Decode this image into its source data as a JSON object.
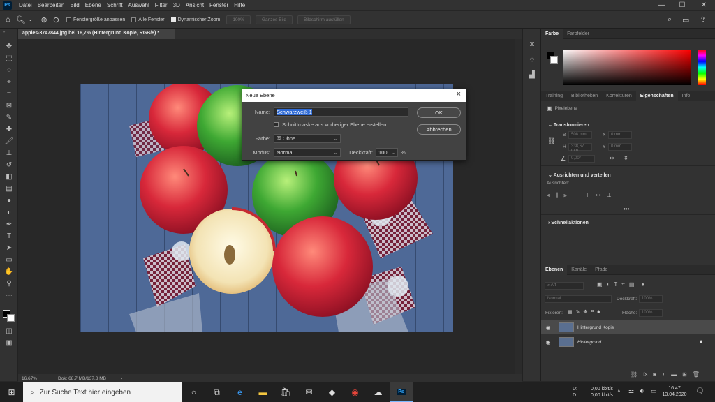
{
  "menubar": {
    "logo": "Ps",
    "items": [
      "Datei",
      "Bearbeiten",
      "Bild",
      "Ebene",
      "Schrift",
      "Auswahl",
      "Filter",
      "3D",
      "Ansicht",
      "Fenster",
      "Hilfe"
    ],
    "minimize": "—",
    "maximize": "☐",
    "close": "✕"
  },
  "options": {
    "fit_window": "Fenstergröße anpassen",
    "all_windows": "Alle Fenster",
    "dynamic_zoom": "Dynamischer Zoom",
    "zoom_value": "100%",
    "whole_image": "Ganzes Bild",
    "fill_screen": "Bildschirm ausfüllen"
  },
  "document": {
    "tab_title": "apples-3747844.jpg bei 16,7% (Hintergrund Kopie, RGB/8) *",
    "zoom": "16,67%",
    "doc_info": "Dok: 68,7 MB/137,3 MB"
  },
  "dialog": {
    "title": "Neue Ebene",
    "name_label": "Name:",
    "name_value": "Schwarzweiß 1",
    "clip_mask": "Schnittmaske aus vorheriger Ebene erstellen",
    "color_label": "Farbe:",
    "color_value": "Ohne",
    "mode_label": "Modus:",
    "mode_value": "Normal",
    "opacity_label": "Deckkraft:",
    "opacity_value": "100",
    "opacity_unit": "%",
    "ok": "OK",
    "cancel": "Abbrechen"
  },
  "color_panel": {
    "tabs": [
      "Farbe",
      "Farbfelder"
    ]
  },
  "properties_panel": {
    "tabs": [
      "Training",
      "Bibliotheken",
      "Korrekturen",
      "Eigenschaften",
      "Info"
    ],
    "layer_type": "Pixelebene",
    "transform": "Transformieren",
    "w_label": "B",
    "w_value": "508 mm",
    "x_label": "X",
    "x_value": "0 mm",
    "h_label": "H",
    "h_value": "338,67 mm",
    "y_label": "Y",
    "y_value": "0 mm",
    "angle_value": "0,00°",
    "align": "Ausrichten und verteilen",
    "align_sub": "Ausrichten:",
    "more": "•••",
    "quick_actions": "Schnellaktionen"
  },
  "layers_panel": {
    "tabs": [
      "Ebenen",
      "Kanäle",
      "Pfade"
    ],
    "filter_placeholder": "Art",
    "blend_mode": "Normal",
    "opacity_label": "Deckkraft:",
    "opacity_value": "100%",
    "lock_label": "Fixieren:",
    "fill_label": "Fläche:",
    "fill_value": "100%",
    "layers": [
      {
        "name": "Hintergrund Kopie"
      },
      {
        "name": "Hintergrund"
      }
    ]
  },
  "taskbar": {
    "search_placeholder": "Zur Suche Text hier eingeben",
    "net_up_label": "U:",
    "net_up_value": "0,00 kbit/s",
    "net_down_label": "D:",
    "net_down_value": "0,00 kbit/s",
    "time": "16:47",
    "date": "13.04.2020"
  }
}
